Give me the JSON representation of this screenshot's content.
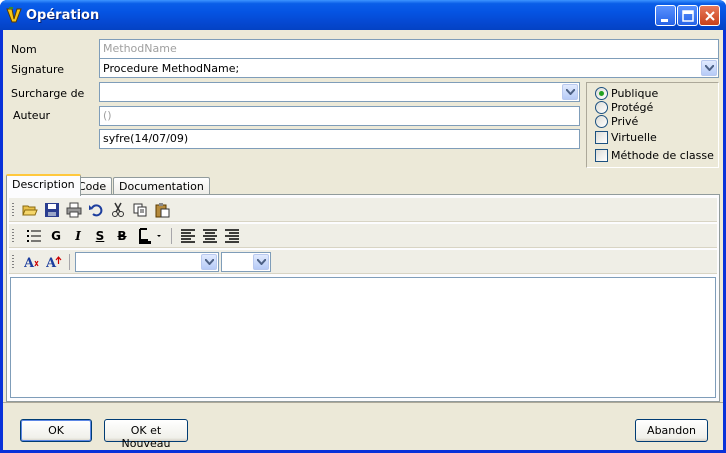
{
  "window": {
    "title": "Opération"
  },
  "form": {
    "nom_label": "Nom",
    "nom_value": "MethodName",
    "signature_label": "Signature",
    "signature_value": "Procedure MethodName;",
    "surcharge_label": "Surcharge de",
    "surcharge_value": "",
    "auteur_label": "Auteur",
    "auteur_value": "()",
    "author_line_value": "syfre(14/07/09)"
  },
  "visibility": {
    "options": [
      {
        "label": "Publique",
        "selected": true
      },
      {
        "label": "Protégé",
        "selected": false
      },
      {
        "label": "Privé",
        "selected": false
      }
    ],
    "virtual_label": "Virtuelle",
    "virtual_checked": false,
    "class_method_label": "Méthode de classe",
    "class_method_checked": false
  },
  "tabs": [
    "Description",
    "Code",
    "Documentation"
  ],
  "active_tab": "Description",
  "toolbar": {
    "row1_icons": [
      "open-icon",
      "save-icon",
      "print-icon",
      "undo-icon",
      "cut-icon",
      "copy-icon",
      "paste-icon"
    ],
    "row2_icons": [
      "bullet-list-icon",
      "bold-icon",
      "italic-icon",
      "strikethrough-icon",
      "strikethrough-icon",
      "font-color-icon",
      "align-left-icon",
      "align-center-icon",
      "align-right-icon"
    ],
    "row2_glyphs": {
      "bold": "G",
      "italic": "I",
      "underline": "S",
      "strike": "B"
    },
    "row3_icons": [
      "font-shrink-icon",
      "font-grow-icon"
    ],
    "font_name_value": "",
    "font_size_value": ""
  },
  "editor": {
    "content": ""
  },
  "buttons": {
    "ok": "OK",
    "ok_new": "OK et Nouveau",
    "cancel": "Abandon"
  },
  "colors": {
    "titlebar": "#0554e3",
    "client_bg": "#ece9d8",
    "tab_highlight": "#ffc83c",
    "radio_selected": "#21a121"
  }
}
